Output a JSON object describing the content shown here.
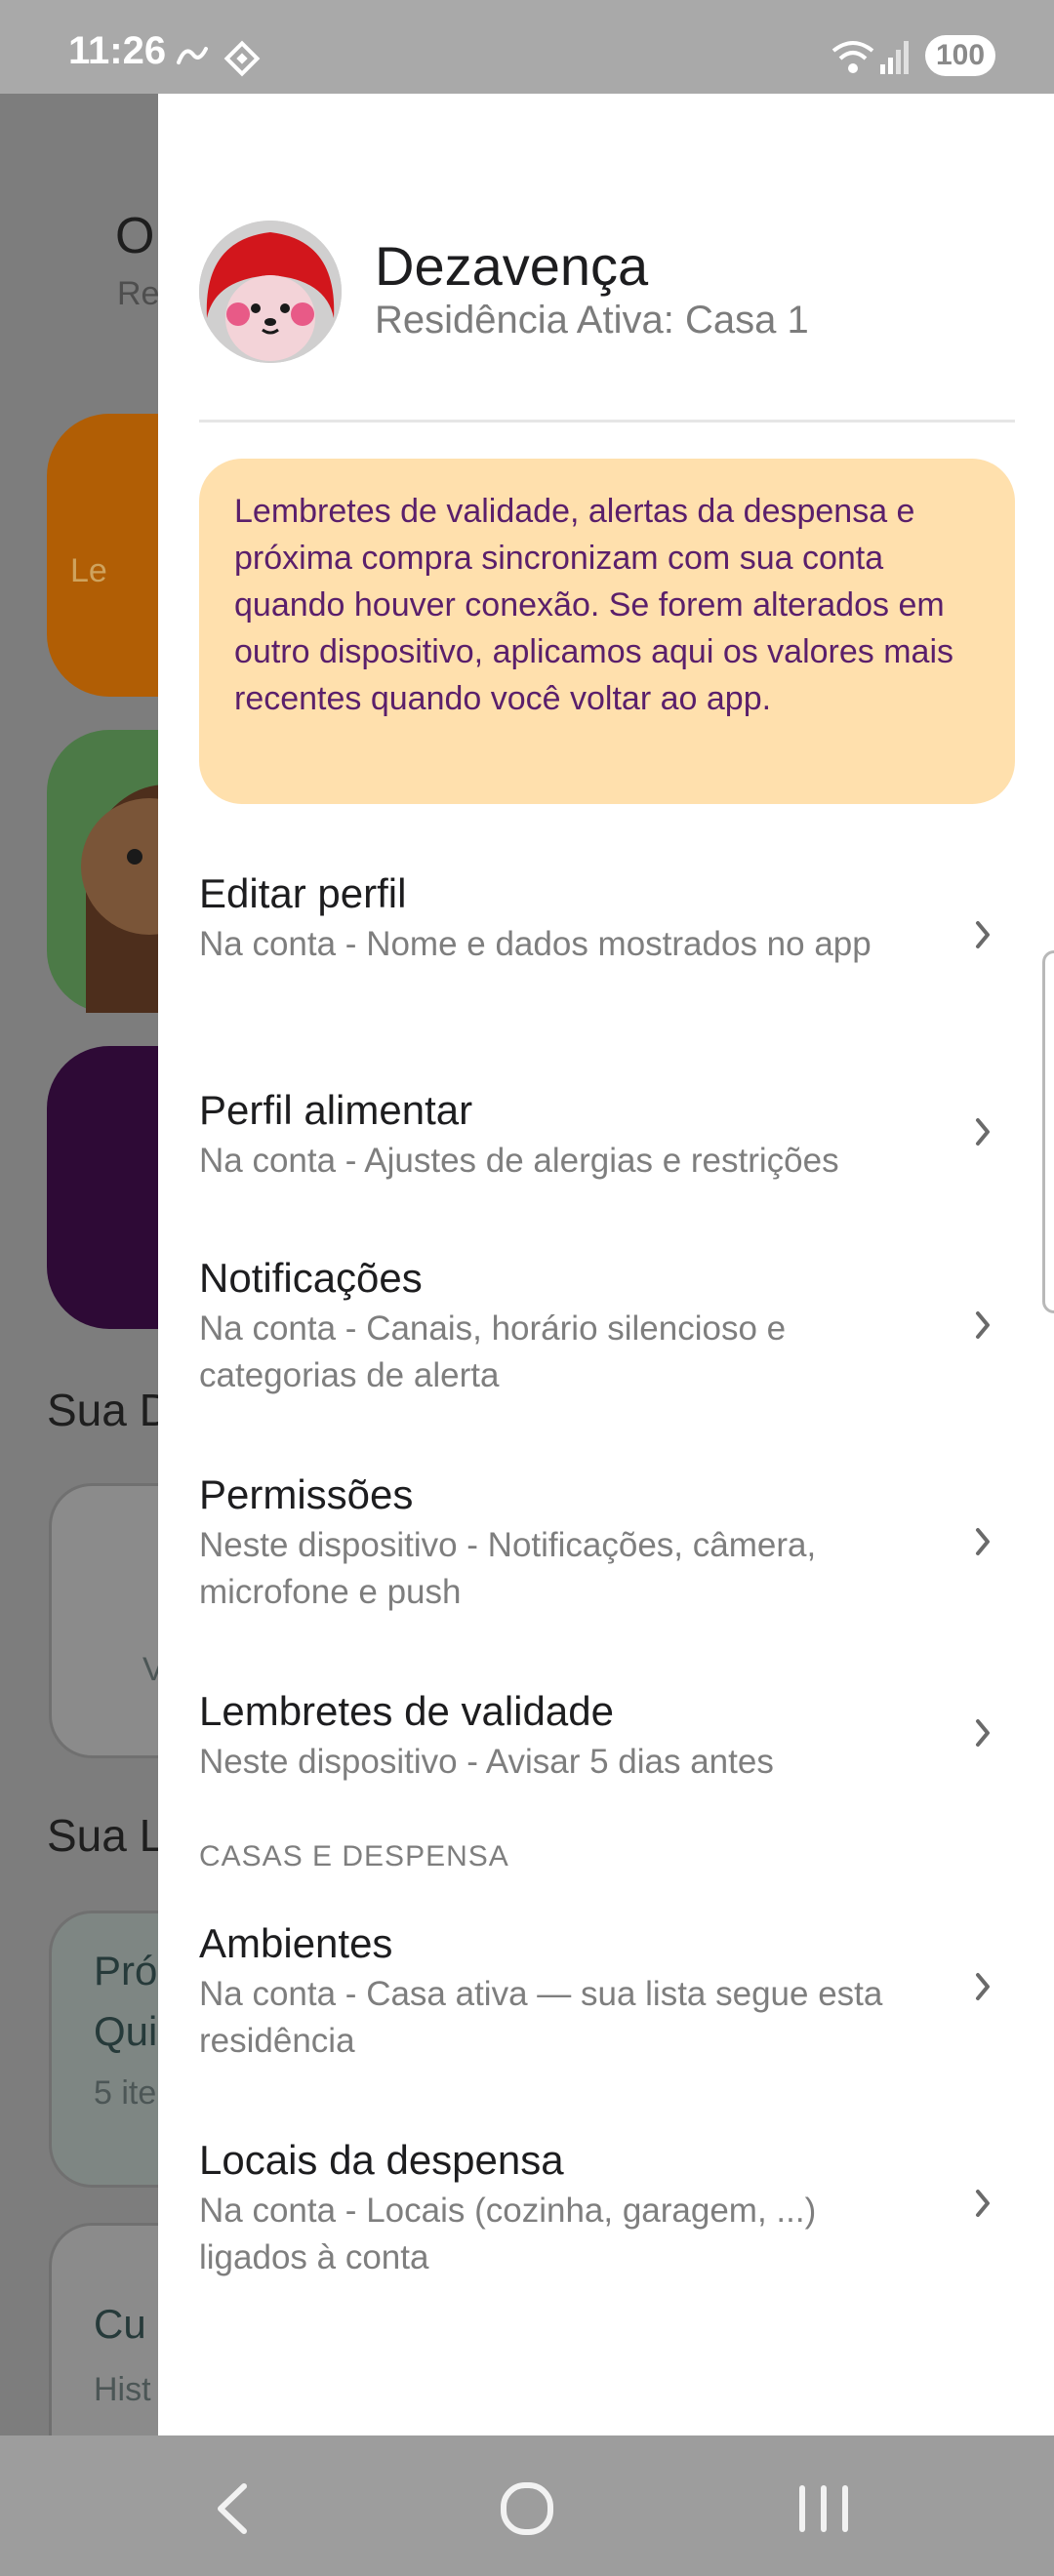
{
  "status_bar": {
    "time": "11:26",
    "battery": "100",
    "icons": [
      "link-icon",
      "diamond-icon",
      "wifi-icon",
      "signal-icon",
      "battery-icon"
    ]
  },
  "background": {
    "title": "O",
    "subtitle": "Re",
    "card_text": "Le",
    "section1": "Sua D",
    "section1_item": "V",
    "section2": "Sua L",
    "list_card_title": "Pró",
    "list_card_sub": "Qui",
    "list_card_count": "5 ite",
    "history_title": "Cu",
    "history_sub": "Hist"
  },
  "profile": {
    "name": "Dezavença",
    "residence": "Residência Ativa: Casa 1"
  },
  "sync_note": "Lembretes de validade, alertas da despensa e próxima compra sincronizam com sua conta quando houver conexão. Se forem alterados em outro dispositivo, aplicamos aqui os valores mais recentes quando você voltar ao app.",
  "menu": [
    {
      "title": "Editar perfil",
      "subtitle": "Na conta - Nome e dados mostrados no app"
    },
    {
      "title": "Perfil alimentar",
      "subtitle": "Na conta - Ajustes de alergias e restrições"
    },
    {
      "title": "Notificações",
      "subtitle": "Na conta - Canais, horário silencioso e categorias de alerta"
    },
    {
      "title": "Permissões",
      "subtitle": "Neste dispositivo - Notificações, câmera, microfone e push"
    },
    {
      "title": "Lembretes de validade",
      "subtitle": "Neste dispositivo - Avisar 5 dias antes"
    }
  ],
  "section_houses": "CASAS E DESPENSA",
  "menu_houses": [
    {
      "title": "Ambientes",
      "subtitle": "Na conta - Casa ativa — sua lista segue esta residência"
    },
    {
      "title": "Locais da despensa",
      "subtitle": "Na conta - Locais (cozinha, garagem, ...) ligados à conta"
    }
  ],
  "nav": [
    "back-icon",
    "home-icon",
    "recents-icon"
  ],
  "colors": {
    "sync_bg": "#ffe0ad",
    "sync_text": "#5a1f6b",
    "card_orange": "#b15e05",
    "card_green": "#4c7a47",
    "card_purple": "#2e0a36"
  }
}
